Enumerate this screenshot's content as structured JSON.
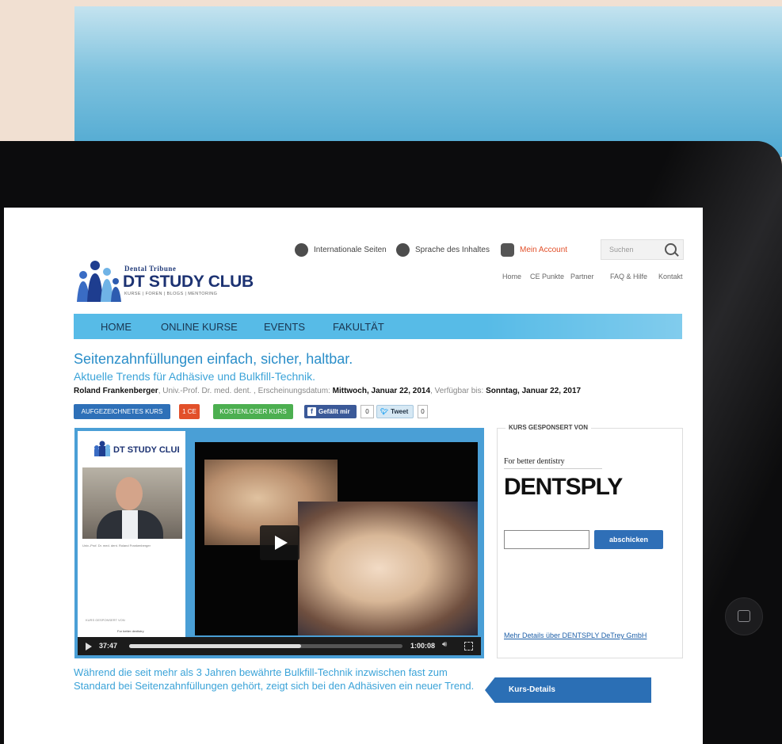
{
  "header": {
    "international_label": "Internationale Seiten",
    "language_label": "Sprache des Inhaltes",
    "account_label": "Mein Account",
    "search_placeholder": "Suchen",
    "sublinks": [
      "Home",
      "CE Punkte",
      "Partner",
      "FAQ & Hilfe",
      "Kontakt"
    ]
  },
  "brand": {
    "top": "Dental Tribune",
    "main": "DT STUDY CLUB",
    "tagline": "KURSE | FOREN | BLOGS | MENTORING"
  },
  "nav": [
    "HOME",
    "ONLINE KURSE",
    "EVENTS",
    "FAKULTÄT"
  ],
  "course": {
    "title": "Seitenzahnfüllungen einfach, sicher, haltbar.",
    "subtitle": "Aktuelle Trends für Adhäsive und Bulkfill-Technik.",
    "author": "Roland Frankenberger",
    "author_title": ", Univ.-Prof. Dr. med. dent. , ",
    "published_label": "Erscheinungsdatum: ",
    "published": "Mittwoch, Januar 22, 2014",
    "available_label": ", Verfügbar bis: ",
    "available": "Sonntag, Januar 22, 2017",
    "description": "Während die seit mehr als 3 Jahren bewährte Bulkfill-Technik inzwischen fast zum Standard bei Seitenzahnfüllungen gehört, zeigt sich bei den Adhäsiven ein neuer Trend."
  },
  "tags": {
    "recorded": "AUFGEZEICHNETES KURS",
    "ce": "1 CE",
    "free": "KOSTENLOSER KURS"
  },
  "social": {
    "like_label": "Gefällt mir",
    "like_count": "0",
    "tweet_label": "Tweet",
    "tweet_count": "0"
  },
  "video": {
    "mini_brand": "DT STUDY CLUB",
    "presenter_caption": "Univ.-Prof. Dr. med. dent. Roland Frankenberger",
    "sidebar_caption": "KURS GESPONSERT VON",
    "sidebar_caption2": "For better dentistry",
    "elapsed": "37:47",
    "duration": "1:00:08",
    "progress": 0.63
  },
  "sponsor": {
    "title": "KURS GESPONSERT VON",
    "tagline": "For better dentistry",
    "logo_text": "DENTSPLY",
    "submit_label": "abschicken",
    "details_link": "Mehr Details über DENTSPLY DeTrey GmbH"
  },
  "kurs_details": "Kurs-Details",
  "colors": {
    "nav_bar": "#57bbe7",
    "title_blue": "#2a8ec9",
    "button_blue": "#2f6fb7",
    "tag_red": "#e2502a",
    "tag_green": "#4caf50",
    "account_orange": "#e2502a"
  }
}
